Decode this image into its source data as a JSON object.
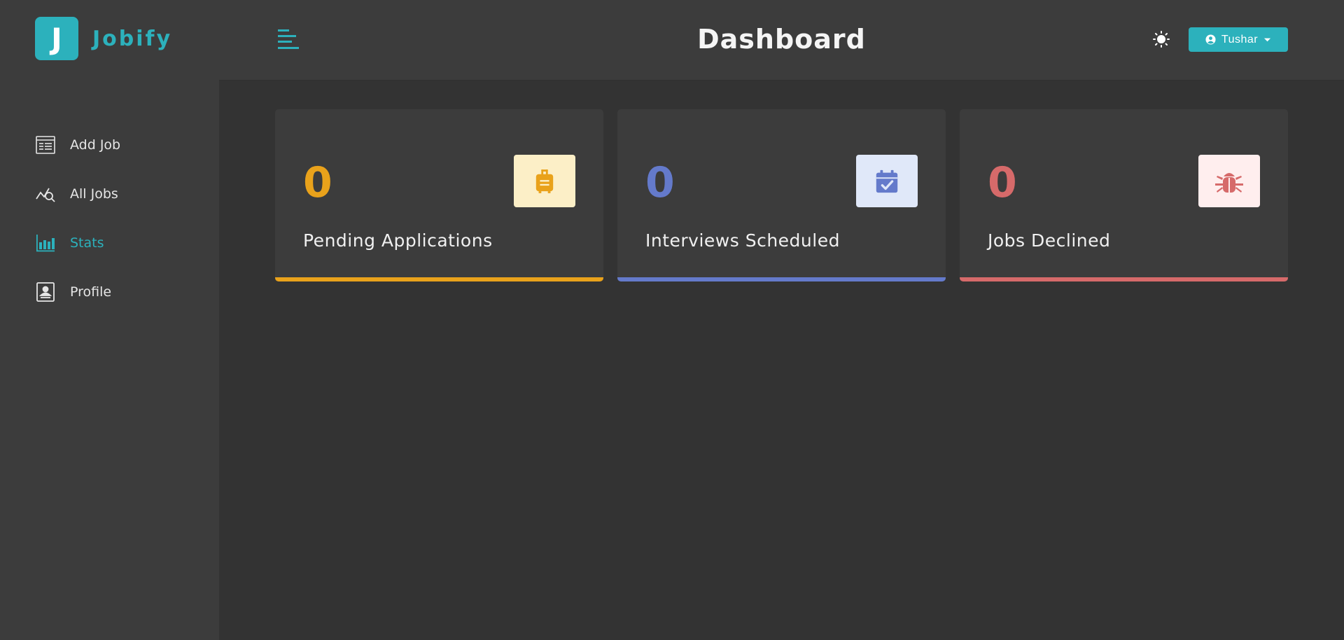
{
  "app": {
    "logo_letter": "J",
    "name": "Jobify"
  },
  "header": {
    "title": "Dashboard",
    "user_name": "Tushar"
  },
  "sidebar": {
    "items": [
      {
        "label": "Add Job",
        "icon": "add-job-icon",
        "active": false
      },
      {
        "label": "All Jobs",
        "icon": "all-jobs-icon",
        "active": false
      },
      {
        "label": "Stats",
        "icon": "stats-icon",
        "active": true
      },
      {
        "label": "Profile",
        "icon": "profile-icon",
        "active": false
      }
    ]
  },
  "stats": [
    {
      "count": "0",
      "label": "Pending Applications",
      "icon": "suitcase-icon",
      "color": "#e9a21b",
      "bg": "#fcefc7"
    },
    {
      "count": "0",
      "label": "Interviews Scheduled",
      "icon": "calendar-check-icon",
      "color": "#647acb",
      "bg": "#e0e8f9"
    },
    {
      "count": "0",
      "label": "Jobs Declined",
      "icon": "bug-icon",
      "color": "#d66a6a",
      "bg": "#ffeeee"
    }
  ],
  "colors": {
    "accent": "#2cb1bc",
    "background": "#333333",
    "surface": "#3c3c3c"
  }
}
